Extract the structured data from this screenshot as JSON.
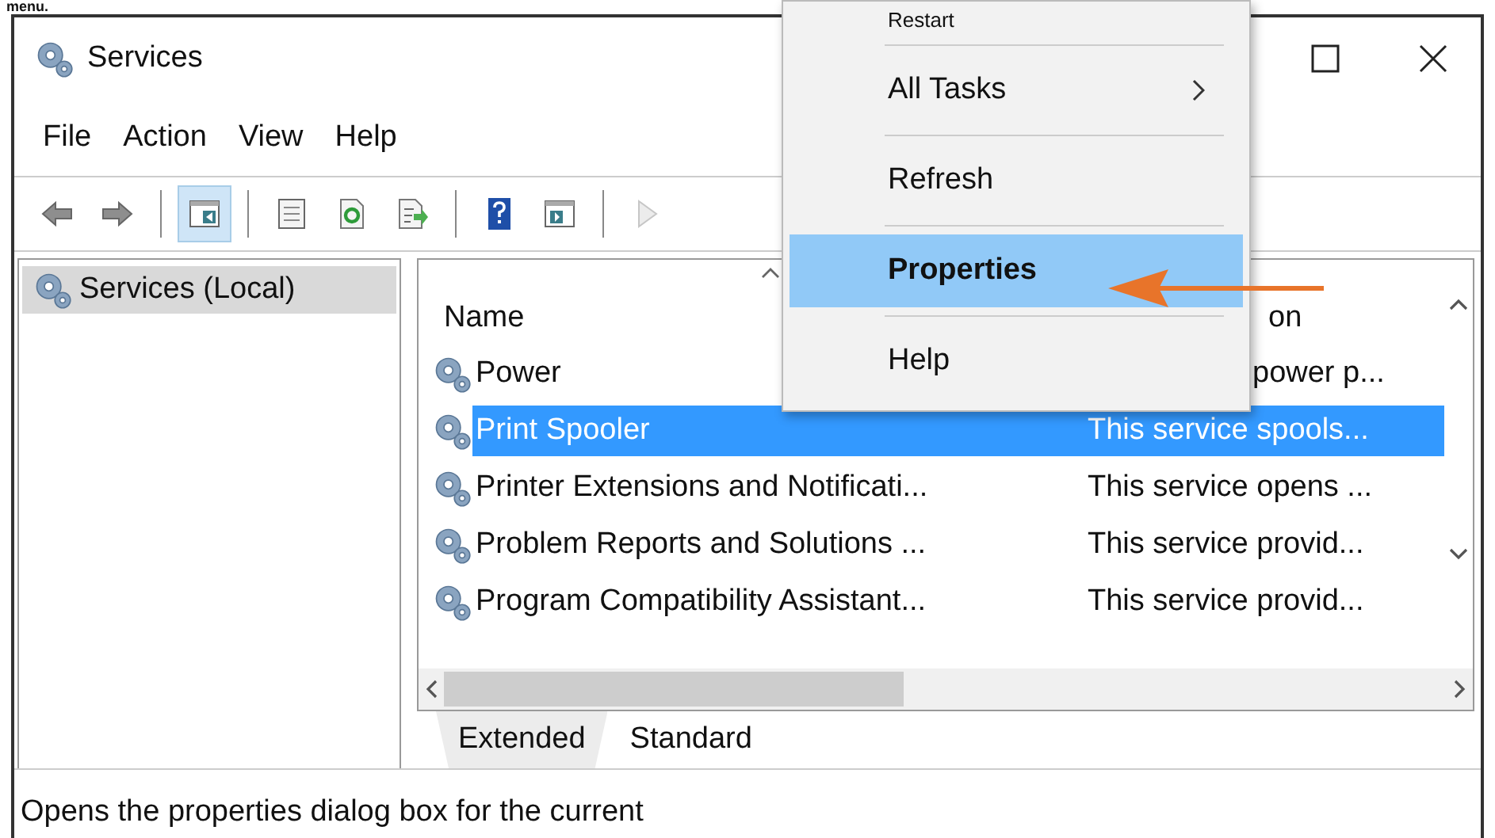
{
  "caption": "menu.",
  "window": {
    "title": "Services"
  },
  "menu_bar": [
    "File",
    "Action",
    "View",
    "Help"
  ],
  "toolbar": [
    [
      {
        "kind": "back",
        "on": false,
        "disabled": false
      },
      {
        "kind": "forward",
        "on": false,
        "disabled": false
      }
    ],
    [
      {
        "kind": "tree-toggle",
        "on": true,
        "disabled": false
      }
    ],
    [
      {
        "kind": "properties",
        "on": false,
        "disabled": false
      },
      {
        "kind": "refresh",
        "on": false,
        "disabled": false
      },
      {
        "kind": "export",
        "on": false,
        "disabled": false
      }
    ],
    [
      {
        "kind": "help",
        "on": false,
        "disabled": false
      },
      {
        "kind": "action-pane",
        "on": false,
        "disabled": false
      }
    ],
    [
      {
        "kind": "play",
        "on": false,
        "disabled": true
      }
    ]
  ],
  "tree": [
    {
      "label": "Services (Local)",
      "selected": true
    }
  ],
  "table": {
    "columns": [
      {
        "label": "Name",
        "sorted": true
      },
      {
        "label": "on"
      }
    ],
    "rows": [
      {
        "name": "Power",
        "description": "power p...",
        "selected": false
      },
      {
        "name": "Print Spooler",
        "description": "This service spools...",
        "selected": true
      },
      {
        "name": "Printer Extensions and Notificati...",
        "description": "This service opens ...",
        "selected": false
      },
      {
        "name": "Problem Reports and Solutions ...",
        "description": "This service provid...",
        "selected": false
      },
      {
        "name": "Program Compatibility Assistant...",
        "description": "This service provid...",
        "selected": false
      }
    ]
  },
  "tabs": [
    {
      "label": "Extended",
      "selected": false
    },
    {
      "label": "Standard",
      "selected": true
    }
  ],
  "status_bar": "Opens the properties dialog box for the current",
  "context_menu": [
    {
      "label": "Restart",
      "selected": false,
      "default": false,
      "submenu": false
    },
    {
      "label": "All Tasks",
      "selected": false,
      "default": false,
      "submenu": true
    },
    {
      "label": "Refresh",
      "selected": false,
      "default": false,
      "submenu": false
    },
    {
      "label": "Properties",
      "selected": true,
      "default": true,
      "submenu": false
    },
    {
      "label": "Help",
      "selected": false,
      "default": false,
      "submenu": false
    }
  ]
}
